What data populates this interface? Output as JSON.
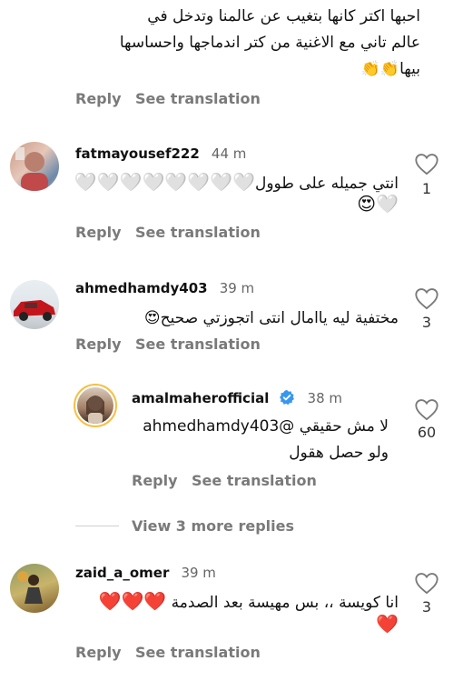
{
  "comments": [
    {
      "id": "top",
      "text_line1": "احبها اكتر كانها بتغيب عن عالمنا وتدخل في",
      "text_line2": "عالم تاني مع الاغنية من كتر اندماجها واحساسها",
      "text_line3": "بيها",
      "emoji": "👏👏",
      "reply": "Reply",
      "see_translation": "See translation"
    },
    {
      "id": "fatma",
      "username": "fatmayousef222",
      "time": "44 m",
      "text_line1": "انتي جميله على طوول",
      "hearts_line1": "🤍🤍🤍🤍🤍🤍🤍🤍",
      "hearts_line2": "😍🤍",
      "likes": "1",
      "reply": "Reply",
      "see_translation": "See translation"
    },
    {
      "id": "ahmed",
      "username": "ahmedhamdy403",
      "time": "39 m",
      "text_line1": "مختفية ليه ياامال انتى اتجوزتي صحيح",
      "emoji": "😍",
      "likes": "3",
      "reply": "Reply",
      "see_translation": "See translation"
    },
    {
      "id": "amal",
      "username": "amalmaherofficial",
      "time": "38 m",
      "text_line1": "لا مش حقيقي @ahmedhamdy403",
      "text_line2": "ولو حصل هقول",
      "likes": "60",
      "reply": "Reply",
      "see_translation": "See translation"
    },
    {
      "id": "zaid",
      "username": "zaid_a_omer",
      "time": "39 m",
      "text_line1": "انا كويسة ،، بس مهيسة بعد الصدمة",
      "hearts_line1": "❤️❤️❤️",
      "hearts_line2": "❤️",
      "likes": "3",
      "reply": "Reply",
      "see_translation": "See translation"
    }
  ],
  "view_more": "View 3 more replies",
  "colors": {
    "verified": "#3897f0",
    "heart_red": "#e02020",
    "muted": "#7a7a7a"
  }
}
